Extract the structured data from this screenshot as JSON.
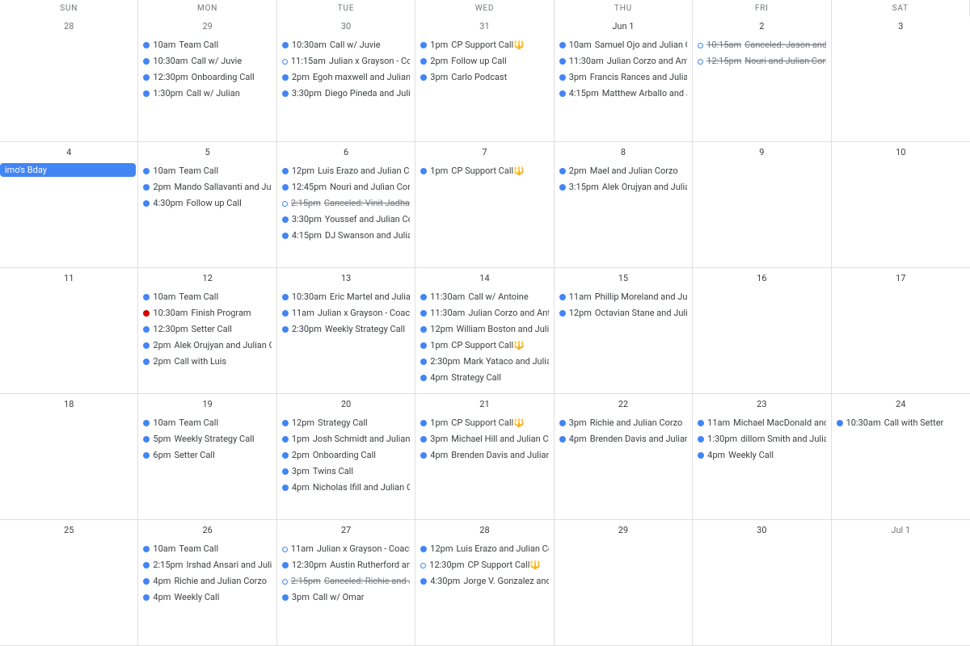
{
  "dow": [
    "SUN",
    "MON",
    "TUE",
    "WED",
    "THU",
    "FRI",
    "SAT"
  ],
  "cells": [
    {
      "num": "28",
      "other": true,
      "events": []
    },
    {
      "num": "29",
      "other": true,
      "events": [
        {
          "dot": "solid-blue",
          "time": "10am",
          "title": "Team Call"
        },
        {
          "dot": "solid-blue",
          "time": "10:30am",
          "title": "Call w/ Juvie"
        },
        {
          "dot": "solid-blue",
          "time": "12:30pm",
          "title": "Onboarding Call"
        },
        {
          "dot": "solid-blue",
          "time": "1:30pm",
          "title": "Call w/ Julian"
        }
      ]
    },
    {
      "num": "30",
      "other": true,
      "events": [
        {
          "dot": "solid-blue",
          "time": "10:30am",
          "title": "Call w/ Juvie"
        },
        {
          "dot": "hollow-blue",
          "time": "11:15am",
          "title": "Julian x Grayson - Coaching"
        },
        {
          "dot": "solid-blue",
          "time": "2pm",
          "title": "Egoh maxwell and Julian Corzo"
        },
        {
          "dot": "solid-blue",
          "time": "3:30pm",
          "title": "Diego Pineda and Julian Corzo"
        }
      ]
    },
    {
      "num": "31",
      "other": true,
      "events": [
        {
          "dot": "solid-blue",
          "time": "1pm",
          "title": "CP Support Call🔱"
        },
        {
          "dot": "solid-blue",
          "time": "2pm",
          "title": "Follow up Call"
        },
        {
          "dot": "solid-blue",
          "time": "3pm",
          "title": "Carlo Podcast"
        }
      ]
    },
    {
      "num": "Jun 1",
      "events": [
        {
          "dot": "solid-blue",
          "time": "10am",
          "title": "Samuel Ojo and Julian Corzo"
        },
        {
          "dot": "solid-blue",
          "time": "11:30am",
          "title": "Julian Corzo and Antoine"
        },
        {
          "dot": "solid-blue",
          "time": "3pm",
          "title": "Francis Rances and Julian Corzo"
        },
        {
          "dot": "solid-blue",
          "time": "4:15pm",
          "title": "Matthew Arballo and Julian"
        }
      ]
    },
    {
      "num": "2",
      "events": [
        {
          "dot": "hollow-blue",
          "time": "10:15am",
          "title": "Canceled: Jason and Julian",
          "cancel": true
        },
        {
          "dot": "hollow-blue",
          "time": "12:15pm",
          "title": "Nouri and Julian Corzo",
          "cancel": true
        }
      ]
    },
    {
      "num": "3",
      "events": []
    },
    {
      "num": "4",
      "allday": "imo's Bday",
      "events": []
    },
    {
      "num": "5",
      "events": [
        {
          "dot": "solid-blue",
          "time": "10am",
          "title": "Team Call"
        },
        {
          "dot": "solid-blue",
          "time": "2pm",
          "title": "Mando Sallavanti and Julian"
        },
        {
          "dot": "solid-blue",
          "time": "4:30pm",
          "title": "Follow up Call"
        }
      ]
    },
    {
      "num": "6",
      "events": [
        {
          "dot": "solid-blue",
          "time": "12pm",
          "title": "Luis Erazo and Julian Corzo"
        },
        {
          "dot": "solid-blue",
          "time": "12:45pm",
          "title": "Nouri and Julian Corzo"
        },
        {
          "dot": "hollow-blue",
          "time": "2:15pm",
          "title": "Canceled: Vinit Jadhav and",
          "cancel": true
        },
        {
          "dot": "solid-blue",
          "time": "3:30pm",
          "title": "Youssef and Julian Corzo"
        },
        {
          "dot": "solid-blue",
          "time": "4:15pm",
          "title": "DJ Swanson and Julian Corzo"
        }
      ]
    },
    {
      "num": "7",
      "events": [
        {
          "dot": "solid-blue",
          "time": "1pm",
          "title": "CP Support Call🔱"
        }
      ]
    },
    {
      "num": "8",
      "events": [
        {
          "dot": "solid-blue",
          "time": "2pm",
          "title": "Mael and Julian Corzo"
        },
        {
          "dot": "solid-blue",
          "time": "3:15pm",
          "title": "Alek Orujyan and Julian Corzo"
        }
      ]
    },
    {
      "num": "9",
      "events": []
    },
    {
      "num": "10",
      "events": []
    },
    {
      "num": "11",
      "events": []
    },
    {
      "num": "12",
      "events": [
        {
          "dot": "solid-blue",
          "time": "10am",
          "title": "Team Call"
        },
        {
          "dot": "solid-tomato",
          "time": "10:30am",
          "title": "Finish Program"
        },
        {
          "dot": "solid-blue",
          "time": "12:30pm",
          "title": "Setter Call"
        },
        {
          "dot": "solid-blue",
          "time": "2pm",
          "title": "Alek Orujyan and Julian Corzo"
        },
        {
          "dot": "solid-blue",
          "time": "2pm",
          "title": "Call with Luis"
        }
      ]
    },
    {
      "num": "13",
      "events": [
        {
          "dot": "solid-blue",
          "time": "10:30am",
          "title": "Eric Martel and Julian Corzo"
        },
        {
          "dot": "solid-blue",
          "time": "11am",
          "title": "Julian x Grayson - Coaching"
        },
        {
          "dot": "solid-blue",
          "time": "2:30pm",
          "title": "Weekly Strategy Call"
        }
      ]
    },
    {
      "num": "14",
      "events": [
        {
          "dot": "solid-blue",
          "time": "11:30am",
          "title": "Call w/ Antoine"
        },
        {
          "dot": "solid-blue",
          "time": "11:30am",
          "title": "Julian Corzo and Antoine"
        },
        {
          "dot": "solid-blue",
          "time": "12pm",
          "title": "William Boston and Julian Corzo"
        },
        {
          "dot": "solid-blue",
          "time": "1pm",
          "title": "CP Support Call🔱"
        },
        {
          "dot": "solid-blue",
          "time": "2:30pm",
          "title": "Mark Yataco and Julian Corzo"
        },
        {
          "dot": "solid-blue",
          "time": "4pm",
          "title": "Strategy Call"
        }
      ]
    },
    {
      "num": "15",
      "events": [
        {
          "dot": "solid-blue",
          "time": "11am",
          "title": "Phillip Moreland and Julian"
        },
        {
          "dot": "solid-blue",
          "time": "12pm",
          "title": "Octavian Stane and Julian"
        }
      ]
    },
    {
      "num": "16",
      "events": []
    },
    {
      "num": "17",
      "events": []
    },
    {
      "num": "18",
      "events": []
    },
    {
      "num": "19",
      "events": [
        {
          "dot": "solid-blue",
          "time": "10am",
          "title": "Team Call"
        },
        {
          "dot": "solid-blue",
          "time": "5pm",
          "title": "Weekly Strategy Call"
        },
        {
          "dot": "solid-blue",
          "time": "6pm",
          "title": "Setter Call"
        }
      ]
    },
    {
      "num": "20",
      "events": [
        {
          "dot": "solid-blue",
          "time": "12pm",
          "title": "Strategy Call"
        },
        {
          "dot": "solid-blue",
          "time": "1pm",
          "title": "Josh Schmidt and Julian Corzo"
        },
        {
          "dot": "solid-blue",
          "time": "2pm",
          "title": "Onboarding Call"
        },
        {
          "dot": "solid-blue",
          "time": "3pm",
          "title": "Twins Call"
        },
        {
          "dot": "solid-blue",
          "time": "4pm",
          "title": "Nicholas Ifill and Julian Corzo"
        }
      ]
    },
    {
      "num": "21",
      "events": [
        {
          "dot": "solid-blue",
          "time": "1pm",
          "title": "CP Support Call🔱"
        },
        {
          "dot": "solid-blue",
          "time": "3pm",
          "title": "Michael Hill and Julian Corzo"
        },
        {
          "dot": "solid-blue",
          "time": "4pm",
          "title": "Brenden Davis and Julian Corzo"
        }
      ]
    },
    {
      "num": "22",
      "events": [
        {
          "dot": "solid-blue",
          "time": "3pm",
          "title": "Richie and Julian Corzo"
        },
        {
          "dot": "solid-blue",
          "time": "4pm",
          "title": "Brenden Davis and Julian Corzo"
        }
      ]
    },
    {
      "num": "23",
      "events": [
        {
          "dot": "solid-blue",
          "time": "11am",
          "title": "Michael MacDonald and Julian"
        },
        {
          "dot": "solid-blue",
          "time": "1:30pm",
          "title": "dillom Smith and Julian Corzo"
        },
        {
          "dot": "solid-blue",
          "time": "4pm",
          "title": "Weekly Call"
        }
      ]
    },
    {
      "num": "24",
      "events": [
        {
          "dot": "solid-blue",
          "time": "10:30am",
          "title": "Call with Setter"
        }
      ]
    },
    {
      "num": "25",
      "events": []
    },
    {
      "num": "26",
      "events": [
        {
          "dot": "solid-blue",
          "time": "10am",
          "title": "Team Call"
        },
        {
          "dot": "solid-blue",
          "time": "2:15pm",
          "title": "Irshad Ansari and Julian Corzo"
        },
        {
          "dot": "solid-blue",
          "time": "4pm",
          "title": "Richie and Julian Corzo"
        },
        {
          "dot": "solid-blue",
          "time": "4pm",
          "title": "Weekly Call"
        }
      ]
    },
    {
      "num": "27",
      "events": [
        {
          "dot": "hollow-blue",
          "time": "11am",
          "title": "Julian x Grayson - Coaching"
        },
        {
          "dot": "solid-blue",
          "time": "12:30pm",
          "title": "Austin Rutherford and Julian"
        },
        {
          "dot": "hollow-blue",
          "time": "2:15pm",
          "title": "Canceled: Richie and Julian",
          "cancel": true
        },
        {
          "dot": "solid-blue",
          "time": "3pm",
          "title": "Call w/ Omar"
        }
      ]
    },
    {
      "num": "28",
      "events": [
        {
          "dot": "solid-blue",
          "time": "12pm",
          "title": "Luis Erazo and Julian Corzo"
        },
        {
          "dot": "hollow-blue",
          "time": "12:30pm",
          "title": "CP Support Call🔱"
        },
        {
          "dot": "solid-blue",
          "time": "4:30pm",
          "title": "Jorge V. Gonzalez and Julian"
        }
      ]
    },
    {
      "num": "29",
      "events": []
    },
    {
      "num": "30",
      "events": []
    },
    {
      "num": "Jul 1",
      "other": true,
      "events": []
    }
  ]
}
